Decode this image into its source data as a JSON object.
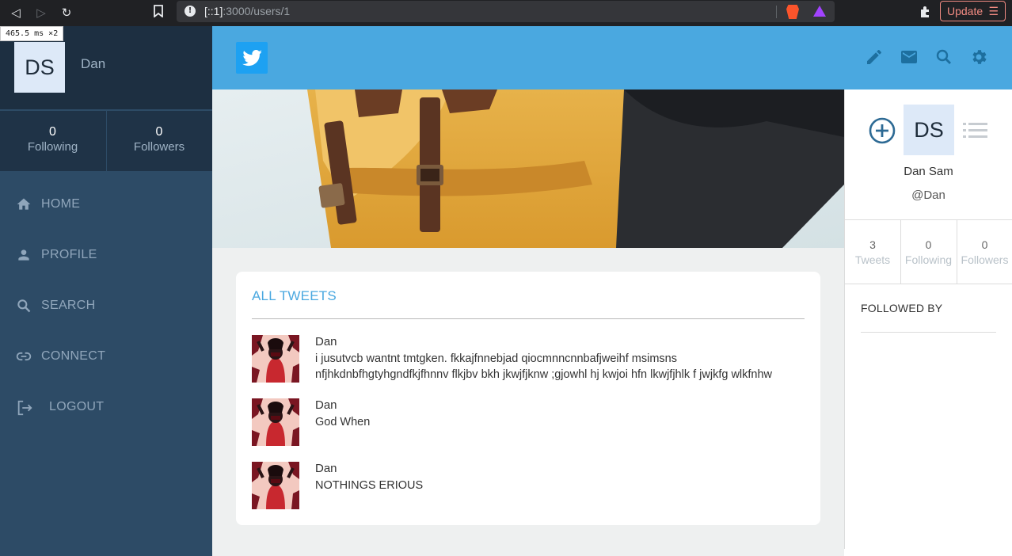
{
  "browser": {
    "url_host": "[::1]",
    "url_path": ":3000/users/1",
    "update_label": "Update",
    "timing_badge": "465.5 ms ×2"
  },
  "sidebar": {
    "avatar_initials": "DS",
    "username": "Dan",
    "following_count": "0",
    "following_label": "Following",
    "followers_count": "0",
    "followers_label": "Followers",
    "nav": [
      {
        "label": "HOME",
        "icon": "home-icon"
      },
      {
        "label": "PROFILE",
        "icon": "person-icon"
      },
      {
        "label": "SEARCH",
        "icon": "search-icon"
      },
      {
        "label": "CONNECT",
        "icon": "link-icon"
      },
      {
        "label": "LOGOUT",
        "icon": "logout-icon"
      }
    ]
  },
  "header": {
    "logo": "twitter-bird-icon",
    "actions": [
      "pencil-icon",
      "mail-icon",
      "search-icon",
      "gear-icon"
    ],
    "accent_color": "#4aa8e0"
  },
  "feed": {
    "title": "ALL TWEETS",
    "tweets": [
      {
        "user": "Dan",
        "text": "i jusutvcb wantnt tmtgken. fkkajfnnebjad qiocmnncnnbafjweihf msimsns\nnfjhkdnbfhgtyhgndfkjfhnnv flkjbv bkh jkwjfjknw ;gjowhl hj kwjoi hfn lkwjfjhlk f jwjkfg wlkfnhw"
      },
      {
        "user": "Dan",
        "text": "God When"
      },
      {
        "user": "Dan",
        "text": "NOTHINGS ERIOUS"
      }
    ]
  },
  "profile_panel": {
    "avatar_initials": "DS",
    "full_name": "Dan Sam",
    "handle": "@Dan",
    "tweets_count": "3",
    "tweets_label": "Tweets",
    "following_count": "0",
    "following_label": "Following",
    "followers_count": "0",
    "followers_label": "Followers",
    "followed_by_label": "FOLLOWED BY"
  }
}
